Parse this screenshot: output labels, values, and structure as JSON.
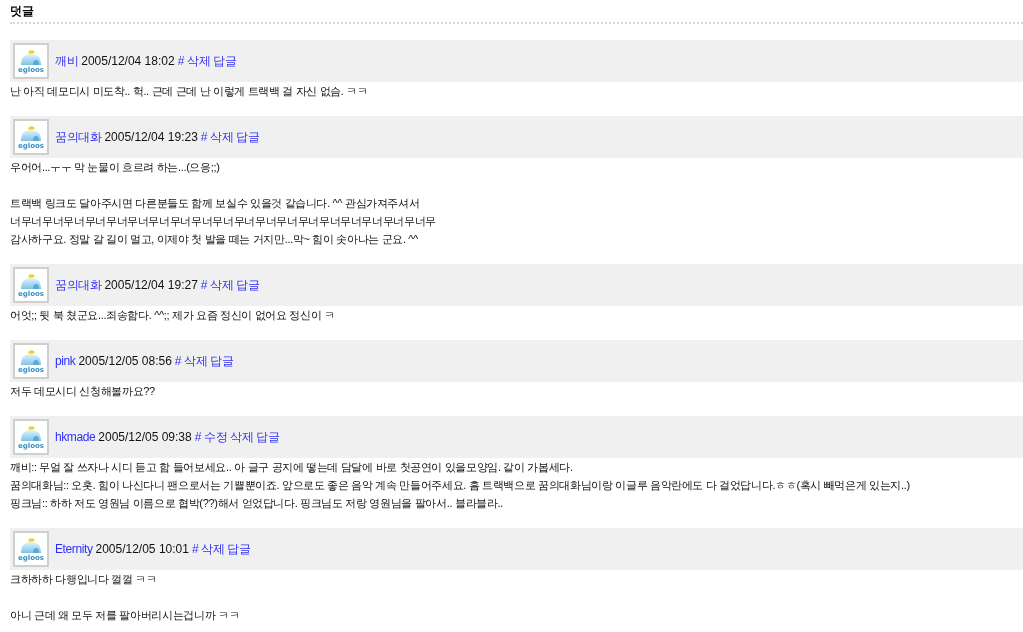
{
  "section": {
    "title": "덧글"
  },
  "comments": [
    {
      "avatar": {
        "label": "egloos"
      },
      "author": "깨비",
      "date": "2005/12/04 18:02",
      "actions": [
        "#",
        "삭제",
        "답글"
      ],
      "paragraphs": [
        [
          "난 아직 데모디시 미도착.. 헉.. 근데 근데 난 이렇게 트랙백 걸 자신 없슴. ㅋㅋ"
        ]
      ]
    },
    {
      "avatar": {
        "label": "egloos"
      },
      "author": "꿈의대화",
      "date": "2005/12/04 19:23",
      "actions": [
        "#",
        "삭제",
        "답글"
      ],
      "paragraphs": [
        [
          "우어어...ㅜㅜ 막 눈물이 흐르려 하는...(으응;;)"
        ],
        [
          "트랙백 링크도 달아주시면 다른분들도 함께 보실수 있을것 같습니다. ^^ 관심가져주셔서",
          "너무너무너무너무너무너무너무너무너무너무너무너무너무너무너무너무너무너무너무너무",
          "감사하구요. 정말 갈 길이 멀고, 이제야 첫 발을 떼는 거지만...막~ 힘이 솟아나는 군요. ^^"
        ]
      ]
    },
    {
      "avatar": {
        "label": "egloos"
      },
      "author": "꿈의대화",
      "date": "2005/12/04 19:27",
      "actions": [
        "#",
        "삭제",
        "답글"
      ],
      "paragraphs": [
        [
          "어엇;; 뒷 북 쳤군요...죄송함다. ^^;; 제가 요즘 정신이 없어요 정신이 ㅋ"
        ]
      ]
    },
    {
      "avatar": {
        "label": "egloos"
      },
      "author": "pink",
      "date": "2005/12/05 08:56",
      "actions": [
        "#",
        "삭제",
        "답글"
      ],
      "paragraphs": [
        [
          "저두 데모시디 신청해볼까요??"
        ]
      ]
    },
    {
      "avatar": {
        "label": "egloos"
      },
      "author": "hkmade",
      "date": "2005/12/05 09:38",
      "actions": [
        "#",
        "수정",
        "삭제",
        "답글"
      ],
      "paragraphs": [
        [
          "깨비:: 무얼 잘 쓰자나 시디 듣고 함 들어보세요.. 아 글구 공지에 떻는데 담달에 바로 첫공연이 있을모양임. 같이 가봅세다.",
          "꿈의대화님:: 오홋. 힘이 나신다니 팬으로서는 기쁠뿐이죠. 앞으로도 좋은 음악 계속 만들어주세요. 흠 트랙백으로 꿈의대화님이랑 이글루 음악란에도 다 걸었답니다.ㅎㅎ(혹시 빼먹은게 있는지..)",
          "핑크님:: 하하 저도 영원님 이름으로 협박(??)해서 얻었답니다. 핑크님도 저랑 영원님을 팔아서.. 블라블라.."
        ]
      ]
    },
    {
      "avatar": {
        "label": "egloos"
      },
      "author": "Eternity",
      "date": "2005/12/05 10:01",
      "actions": [
        "#",
        "삭제",
        "답글"
      ],
      "paragraphs": [
        [
          "크하하하 다행입니다 껄껄 ㅋㅋ"
        ],
        [
          "아니 근데 왜 모두 저를 팔아버리시는겁니까 ㅋㅋ"
        ]
      ]
    }
  ]
}
